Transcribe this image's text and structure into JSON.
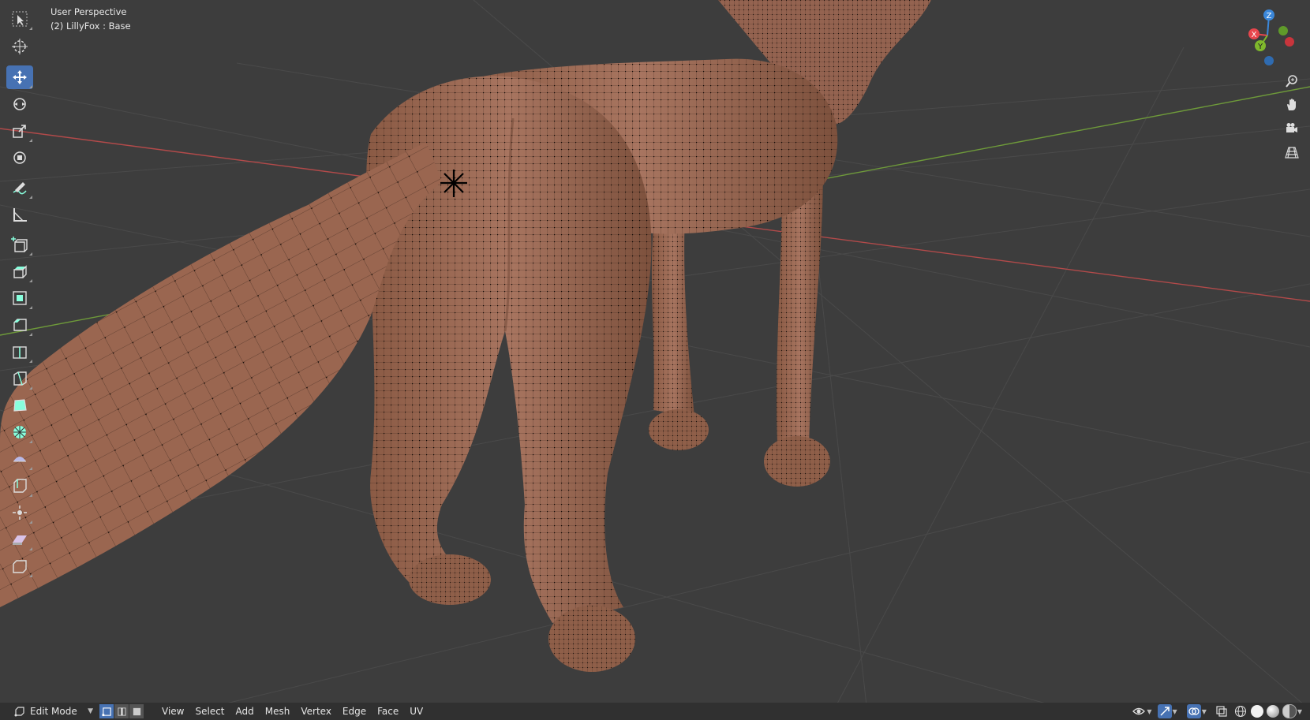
{
  "viewport": {
    "title": "User Perspective",
    "object": "(2) LillyFox : Base"
  },
  "toolbar": {
    "tools": [
      {
        "name": "select-box",
        "active": false
      },
      {
        "name": "cursor",
        "active": false
      },
      {
        "name": "move",
        "active": true
      },
      {
        "name": "rotate",
        "active": false
      },
      {
        "name": "scale",
        "active": false
      },
      {
        "name": "transform",
        "active": false
      },
      {
        "name": "annotate",
        "active": false
      },
      {
        "name": "measure",
        "active": false
      },
      {
        "name": "add-cube",
        "active": false
      },
      {
        "name": "extrude-region",
        "active": false
      },
      {
        "name": "inset-faces",
        "active": false
      },
      {
        "name": "bevel",
        "active": false
      },
      {
        "name": "loop-cut",
        "active": false
      },
      {
        "name": "knife",
        "active": false
      },
      {
        "name": "poly-build",
        "active": false
      },
      {
        "name": "spin",
        "active": false
      },
      {
        "name": "smooth",
        "active": false
      },
      {
        "name": "edge-slide",
        "active": false
      },
      {
        "name": "shrink-fatten",
        "active": false
      },
      {
        "name": "shear",
        "active": false
      },
      {
        "name": "rip-region",
        "active": false
      }
    ]
  },
  "gizmo": {
    "z_label": "Z",
    "y_label": "Y",
    "x_label": "X",
    "colors": {
      "x": "#e8464d",
      "y": "#7fb82c",
      "z": "#3b87d9"
    }
  },
  "nav_buttons": [
    "zoom-icon",
    "hand-pan-icon",
    "camera-icon",
    "perspective-grid-icon"
  ],
  "header": {
    "mode": "Edit Mode",
    "menus": [
      "View",
      "Select",
      "Add",
      "Mesh",
      "Vertex",
      "Edge",
      "Face",
      "UV"
    ],
    "select_modes": [
      "vertex",
      "edge",
      "face"
    ],
    "active_select_mode": "vertex"
  },
  "colors": {
    "background": "#3d3d3d",
    "mesh": "#9b6a52",
    "accent": "#4772b3",
    "axis_x": "#b24a4a",
    "axis_y": "#6e9a3a"
  }
}
